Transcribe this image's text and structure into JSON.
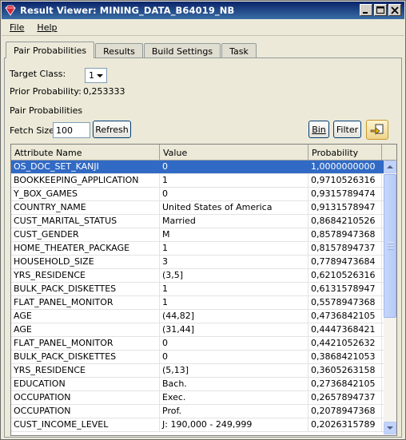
{
  "window": {
    "title": "Result Viewer: MINING_DATA_B64019_NB"
  },
  "menu": {
    "file": "File",
    "help": "Help"
  },
  "tabs": [
    {
      "label": "Pair Probabilities",
      "active": true
    },
    {
      "label": "Results",
      "active": false
    },
    {
      "label": "Build Settings",
      "active": false
    },
    {
      "label": "Task",
      "active": false
    }
  ],
  "form": {
    "target_class_label": "Target Class:",
    "target_class_value": "1",
    "prior_probability_label": "Prior Probability:",
    "prior_probability_value": "0,253333",
    "section_label": "Pair Probabilities",
    "fetch_size_label": "Fetch Size:",
    "fetch_size_value": "100",
    "refresh_label": "Refresh",
    "bin_label": "Bin",
    "filter_label": "Filter"
  },
  "grid": {
    "headers": [
      "Attribute Name",
      "Value",
      "Probability"
    ],
    "rows": [
      {
        "attr": "OS_DOC_SET_KANJI",
        "value": "0",
        "prob": "1,0000000000"
      },
      {
        "attr": "BOOKKEEPING_APPLICATION",
        "value": "1",
        "prob": "0,9710526316"
      },
      {
        "attr": "Y_BOX_GAMES",
        "value": "0",
        "prob": "0,9315789474"
      },
      {
        "attr": "COUNTRY_NAME",
        "value": "United States of America",
        "prob": "0,9131578947"
      },
      {
        "attr": "CUST_MARITAL_STATUS",
        "value": "Married",
        "prob": "0,8684210526"
      },
      {
        "attr": "CUST_GENDER",
        "value": "M",
        "prob": "0,8578947368"
      },
      {
        "attr": "HOME_THEATER_PACKAGE",
        "value": "1",
        "prob": "0,8157894737"
      },
      {
        "attr": "HOUSEHOLD_SIZE",
        "value": "3",
        "prob": "0,7789473684"
      },
      {
        "attr": "YRS_RESIDENCE",
        "value": "(3,5]",
        "prob": "0,6210526316"
      },
      {
        "attr": "BULK_PACK_DISKETTES",
        "value": "1",
        "prob": "0,6131578947"
      },
      {
        "attr": "FLAT_PANEL_MONITOR",
        "value": "1",
        "prob": "0,5578947368"
      },
      {
        "attr": "AGE",
        "value": "(44,82]",
        "prob": "0,4736842105"
      },
      {
        "attr": "AGE",
        "value": "(31,44]",
        "prob": "0,4447368421"
      },
      {
        "attr": "FLAT_PANEL_MONITOR",
        "value": "0",
        "prob": "0,4421052632"
      },
      {
        "attr": "BULK_PACK_DISKETTES",
        "value": "0",
        "prob": "0,3868421053"
      },
      {
        "attr": "YRS_RESIDENCE",
        "value": "(5,13]",
        "prob": "0,3605263158"
      },
      {
        "attr": "EDUCATION",
        "value": "Bach.",
        "prob": "0,2736842105"
      },
      {
        "attr": "OCCUPATION",
        "value": "Exec.",
        "prob": "0,2657894737"
      },
      {
        "attr": "OCCUPATION",
        "value": "Prof.",
        "prob": "0,2078947368"
      },
      {
        "attr": "CUST_INCOME_LEVEL",
        "value": "J: 190,000 - 249,999",
        "prob": "0,2026315789"
      }
    ],
    "selected_index": 0
  },
  "colors": {
    "selection": "#316ac5",
    "titlebar": "#0a246a"
  }
}
